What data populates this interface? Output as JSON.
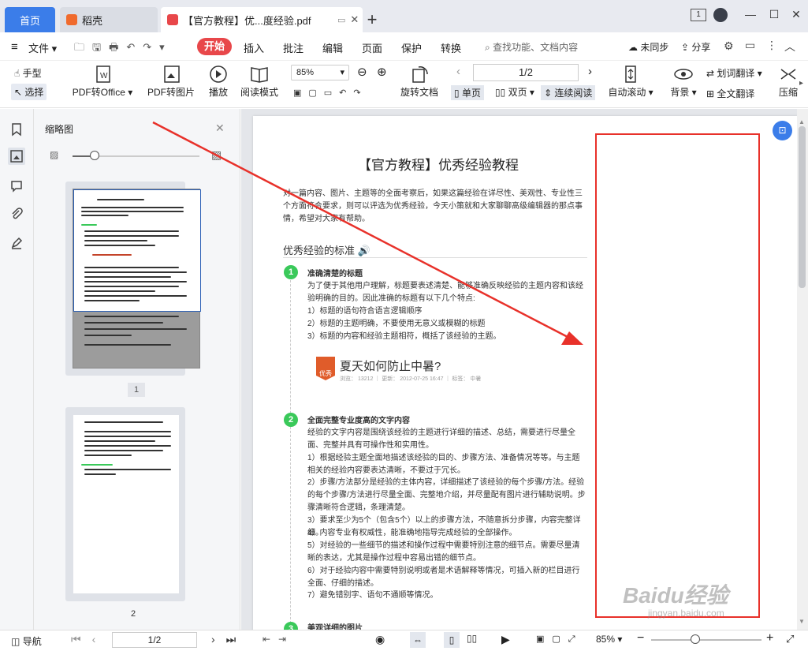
{
  "tabs": {
    "home": "首页",
    "store": "稻壳",
    "doc": "【官方教程】优...度经验.pdf"
  },
  "menu": {
    "file": "文件",
    "start": "开始",
    "insert": "插入",
    "annotate": "批注",
    "edit": "编辑",
    "page": "页面",
    "protect": "保护",
    "convert": "转换",
    "search_placeholder": "查找功能、文档内容",
    "sync": "未同步",
    "share": "分享"
  },
  "toolbar": {
    "hand": "手型",
    "select": "选择",
    "pdf_to_office": "PDF转Office",
    "pdf_to_image": "PDF转图片",
    "play": "播放",
    "read_mode": "阅读模式",
    "zoom": "85%",
    "rotate_doc": "旋转文档",
    "page_indicator": "1/2",
    "single_page": "单页",
    "double_page": "双页",
    "continuous": "连续阅读",
    "auto_scroll": "自动滚动",
    "background": "背景",
    "word_translate": "划词翻译",
    "full_translate": "全文翻译",
    "compress": "压缩"
  },
  "thumbnails": {
    "title": "缩略图",
    "page1_label": "1",
    "page2_label": "2"
  },
  "document": {
    "title": "【官方教程】优秀经验教程",
    "intro": "对一篇内容、图片、主题等的全面考察后，如果这篇经验在详尽性、美观性、专业性三个方面符合要求，则可以评选为优秀经验，今天小策就和大家聊聊高级编辑器的那点事情，希望对大家有帮助。",
    "section_heading": "优秀经验的标准",
    "item1_title": "准确清楚的标题",
    "item1_body": "为了便于其他用户理解，标题要表述清楚、能够准确反映经验的主题内容和该经验明确的目的。因此准确的标题有以下几个特点:",
    "item1_points": [
      "1）标题的语句符合语言逻辑顺序",
      "2）标题的主题明确，不要使用无意义或模糊的标题",
      "3）标题的内容和经验主题相符，概括了该经验的主题。"
    ],
    "example_title": "夏天如何防止中暑?",
    "example_badge": "优秀",
    "example_meta": "浏览： 13212 ｜ 更新： 2012-07-25 16:47 ｜ 标签： 中暑",
    "item2_title": "全面完整专业度高的文字内容",
    "item2_body": "经验的文字内容是围绕该经验的主题进行详细的描述、总结，需要进行尽量全面、完整并具有可操作性和实用性。",
    "item2_points": [
      "1）根据经验主题全面地描述该经验的目的、步骤方法、准备情况等等。与主题相关的经验内容要表达清晰，不要过于冗长。",
      "2）步骤/方法部分是经验的主体内容，详细描述了该经验的每个步骤/方法。经验的每个步骤/方法进行尽量全面、完整地介绍，并尽量配有图片进行辅助说明。步骤清晰符合逻辑，条理清楚。",
      "3）要求至少为5个（包含5个）以上的步骤方法，不随意拆分步骤，内容完整详细。",
      "4）内容专业有权威性，能准确地指导完成经验的全部操作。",
      "5）对经验的一些细节的描述和操作过程中需要特别注意的细节点。需要尽量清晰的表达，尤其是操作过程中容易出错的细节点。",
      "6）对于经验内容中需要特别说明或者是术语解释等情况，可插入新的栏目进行全面、仔细的描述。",
      "7）避免错别字、语句不通顺等情况。"
    ],
    "item3_title": "美观详细的图片"
  },
  "statusbar": {
    "nav": "导航",
    "page_indicator": "1/2",
    "zoom": "85%"
  },
  "watermark": {
    "brand": "Baidu经验",
    "url": "jingyan.baidu.com"
  },
  "colors": {
    "accent": "#3b7de9",
    "start_button": "#e8474a",
    "annotation_red": "#e8312a",
    "step_green": "#3ac95a"
  }
}
